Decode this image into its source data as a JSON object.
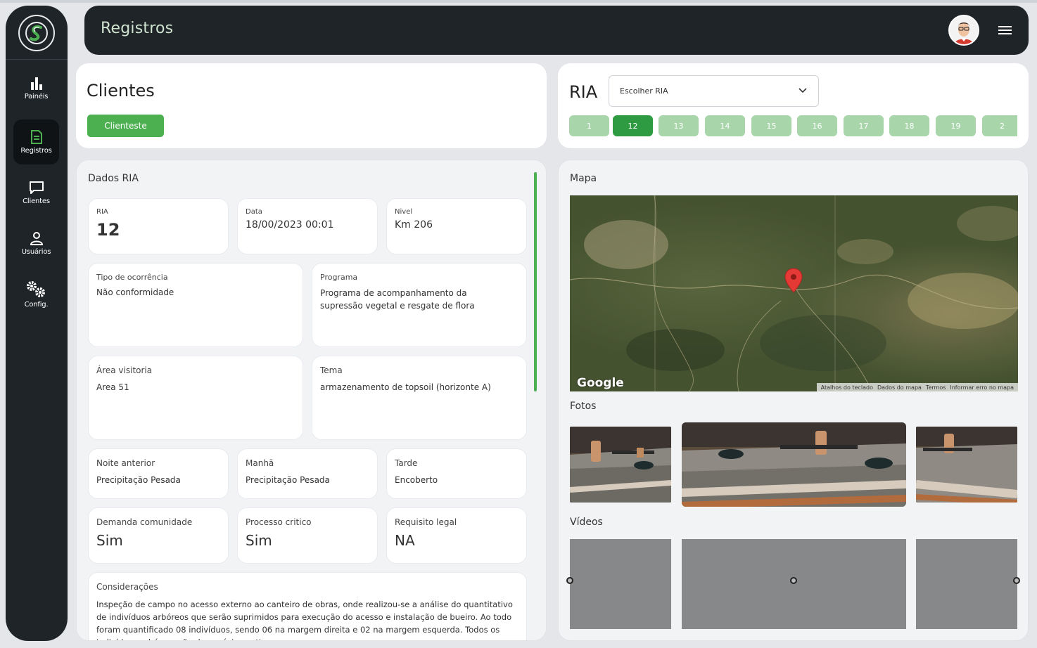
{
  "sidebar": {
    "items": [
      {
        "label": "Painéis",
        "icon": "bar-chart-icon"
      },
      {
        "label": "Registros",
        "icon": "document-icon"
      },
      {
        "label": "Clientes",
        "icon": "chat-icon"
      },
      {
        "label": "Usuários",
        "icon": "user-icon"
      },
      {
        "label": "Config.",
        "icon": "gears-icon"
      }
    ]
  },
  "header": {
    "title": "Registros"
  },
  "clientes": {
    "title": "Clientes",
    "button_label": "Clienteste"
  },
  "ria": {
    "title": "RIA",
    "select_placeholder": "Escolher RIA",
    "pages": [
      "1",
      "12",
      "13",
      "14",
      "15",
      "16",
      "17",
      "18",
      "19",
      "2"
    ],
    "active_page": "12"
  },
  "dados": {
    "title": "Dados RIA",
    "ria_label": "RIA",
    "ria_value": "12",
    "data_label": "Data",
    "data_value": "18/00/2023 00:01",
    "nivel_label": "Nivel",
    "nivel_value": "Km 206",
    "tipo_label": "Tipo de ocorrência",
    "tipo_value": "Não conformidade",
    "programa_label": "Programa",
    "programa_value": "Programa de acompanhamento da supressão vegetal e resgate de flora",
    "area_label": "Área visitoria",
    "area_value": "Area 51",
    "tema_label": "Tema",
    "tema_value": "armazenamento de topsoil (horizonte A)",
    "noite_label": "Noite anterior",
    "noite_value": "Precipitação Pesada",
    "manha_label": "Manhã",
    "manha_value": "Precipitação Pesada",
    "tarde_label": "Tarde",
    "tarde_value": "Encoberto",
    "demanda_label": "Demanda comunidade",
    "demanda_value": "Sim",
    "processo_label": "Processo critico",
    "processo_value": "Sim",
    "requisito_label": "Requisito legal",
    "requisito_value": "NA",
    "consideracoes_label": "Considerações",
    "consideracoes_value": "Inspeção de campo no acesso externo ao canteiro de obras, onde realizou-se a análise do quantitativo de indivíduos arbóreos que serão suprimidos para execução do acesso e instalação de bueiro. Ao todo foram quantificado 08 indivíduos, sendo 06 na margem direita e 02 na margem esquerda. Todos os indivíduos arbóreos são de espécies nativas."
  },
  "media": {
    "map_title": "Mapa",
    "map_brand": "Google",
    "map_footer": [
      "Atalhos do teclado",
      "Dados do mapa",
      "Termos",
      "Informar erro no mapa"
    ],
    "photos_title": "Fotos",
    "videos_title": "Vídeos"
  },
  "colors": {
    "sidebar_bg": "#1f2428",
    "accent_green": "#4caf50",
    "page_active": "#2e9b43",
    "page_inactive": "#a8d5aa"
  }
}
